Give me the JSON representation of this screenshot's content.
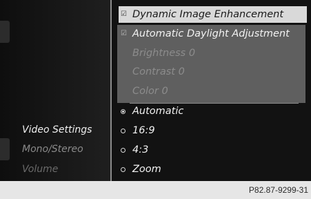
{
  "left_menu": {
    "items": [
      {
        "label": "Video Settings",
        "active": true
      },
      {
        "label": "Mono/Stereo",
        "active": false
      },
      {
        "label": "Volume",
        "active": false
      }
    ]
  },
  "settings": {
    "dynamic_image_enhancement": {
      "label": "Dynamic Image Enhancement",
      "checked": true
    },
    "automatic_daylight_adjustment": {
      "label": "Automatic Daylight Adjustment",
      "checked": true
    },
    "brightness": "Brightness 0",
    "contrast": "Contrast 0",
    "color": "Color 0"
  },
  "aspect_ratio": {
    "options": [
      {
        "label": "Automatic",
        "selected": true
      },
      {
        "label": "16:9",
        "selected": false
      },
      {
        "label": "4:3",
        "selected": false
      },
      {
        "label": "Zoom",
        "selected": false
      }
    ]
  },
  "footer": {
    "figure_code": "P82.87-9299-31"
  },
  "colors": {
    "highlight": "#d9d9d9",
    "subpanel": "#5f5f5f",
    "text_active": "#f2f2f2",
    "text_dim": "#8c8c8c"
  }
}
